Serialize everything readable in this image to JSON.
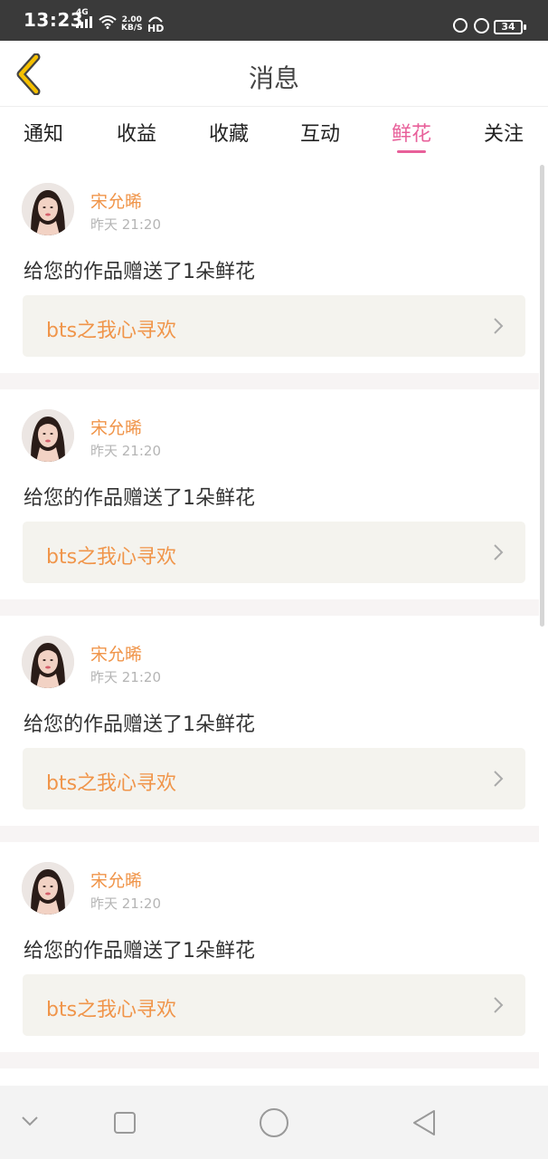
{
  "status_bar": {
    "time": "13:23",
    "network": "4G",
    "speed_value": "2.00",
    "speed_unit": "KB/S",
    "hd": "HD",
    "battery": "34"
  },
  "header": {
    "title": "消息",
    "accent_color": "#f5c000"
  },
  "tabs": [
    {
      "label": "通知"
    },
    {
      "label": "收益"
    },
    {
      "label": "收藏"
    },
    {
      "label": "互动"
    },
    {
      "label": "鲜花"
    },
    {
      "label": "关注"
    }
  ],
  "active_tab": "鲜花",
  "colors": {
    "active_tab": "#e8609a",
    "username": "#f0954a",
    "work_title": "#f0954a"
  },
  "messages": [
    {
      "username": "宋允晞",
      "time": "昨天 21:20",
      "text": "给您的作品赠送了1朵鲜花",
      "work": "bts之我心寻欢"
    },
    {
      "username": "宋允晞",
      "time": "昨天 21:20",
      "text": "给您的作品赠送了1朵鲜花",
      "work": "bts之我心寻欢"
    },
    {
      "username": "宋允晞",
      "time": "昨天 21:20",
      "text": "给您的作品赠送了1朵鲜花",
      "work": "bts之我心寻欢"
    },
    {
      "username": "宋允晞",
      "time": "昨天 21:20",
      "text": "给您的作品赠送了1朵鲜花",
      "work": "bts之我心寻欢"
    }
  ],
  "nav": {
    "icons": [
      "chevron-down-icon",
      "recents-square-icon",
      "home-circle-icon",
      "back-triangle-icon"
    ]
  }
}
